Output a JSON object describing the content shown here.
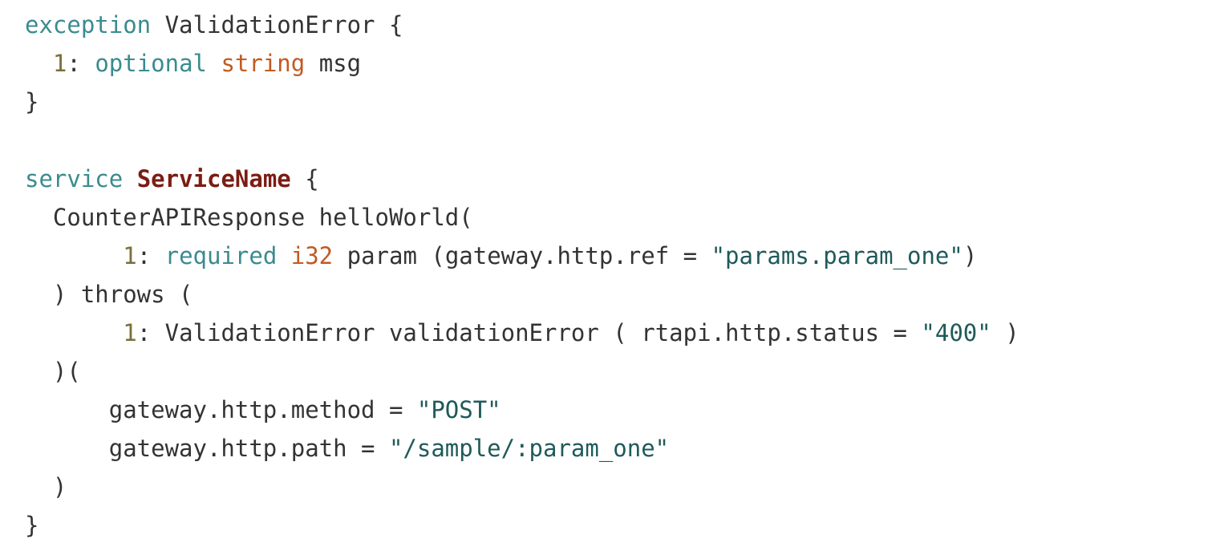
{
  "colors": {
    "keyword": "#3a8b8f",
    "type": "#c25a22",
    "number": "#7b6f3a",
    "class_name": "#7c1c13",
    "string": "#1f5a5a",
    "text": "#333333",
    "background": "#ffffff"
  },
  "code": {
    "lines": [
      [
        {
          "t": "exception",
          "c": "kw"
        },
        {
          "t": " ValidationError {",
          "c": "plain"
        }
      ],
      [
        {
          "t": "  ",
          "c": "plain"
        },
        {
          "t": "1",
          "c": "num"
        },
        {
          "t": ": ",
          "c": "plain"
        },
        {
          "t": "optional",
          "c": "kw"
        },
        {
          "t": " ",
          "c": "plain"
        },
        {
          "t": "string",
          "c": "type"
        },
        {
          "t": " msg",
          "c": "plain"
        }
      ],
      [
        {
          "t": "}",
          "c": "plain"
        }
      ],
      [],
      [
        {
          "t": "service",
          "c": "kw"
        },
        {
          "t": " ",
          "c": "plain"
        },
        {
          "t": "ServiceName",
          "c": "cls"
        },
        {
          "t": " {",
          "c": "plain"
        }
      ],
      [
        {
          "t": "  CounterAPIResponse helloWorld(",
          "c": "plain"
        }
      ],
      [
        {
          "t": "       ",
          "c": "plain"
        },
        {
          "t": "1",
          "c": "num"
        },
        {
          "t": ": ",
          "c": "plain"
        },
        {
          "t": "required",
          "c": "kw"
        },
        {
          "t": " ",
          "c": "plain"
        },
        {
          "t": "i32",
          "c": "type"
        },
        {
          "t": " param (gateway.http.ref = ",
          "c": "plain"
        },
        {
          "t": "\"params.param_one\"",
          "c": "str"
        },
        {
          "t": ")",
          "c": "plain"
        }
      ],
      [
        {
          "t": "  ) throws (",
          "c": "plain"
        }
      ],
      [
        {
          "t": "       ",
          "c": "plain"
        },
        {
          "t": "1",
          "c": "num"
        },
        {
          "t": ": ValidationError validationError ( rtapi.http.status = ",
          "c": "plain"
        },
        {
          "t": "\"400\"",
          "c": "str"
        },
        {
          "t": " )",
          "c": "plain"
        }
      ],
      [
        {
          "t": "  )(",
          "c": "plain"
        }
      ],
      [
        {
          "t": "      gateway.http.method = ",
          "c": "plain"
        },
        {
          "t": "\"POST\"",
          "c": "str"
        }
      ],
      [
        {
          "t": "      gateway.http.path = ",
          "c": "plain"
        },
        {
          "t": "\"/sample/:param_one\"",
          "c": "str"
        }
      ],
      [
        {
          "t": "  )",
          "c": "plain"
        }
      ],
      [
        {
          "t": "}",
          "c": "plain"
        }
      ]
    ]
  }
}
